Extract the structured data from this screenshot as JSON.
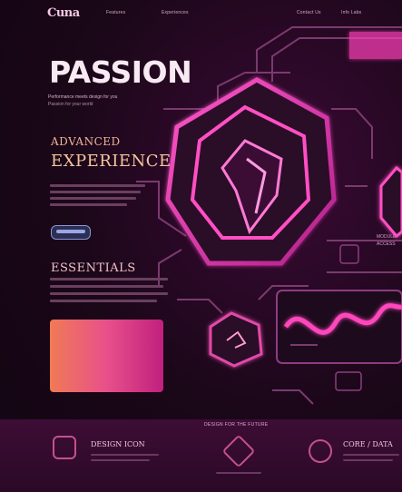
{
  "header": {
    "logo": "Cuna",
    "nav": [
      "Features",
      "Experiences",
      "Contact Us",
      "Info Labs"
    ]
  },
  "hero": {
    "title": "PASSION",
    "tagline": "Performance meets design for you",
    "tagline2": "Passion for your world"
  },
  "section1": {
    "heading_small": "ADVANCED",
    "heading_big": "EXPERIENCE"
  },
  "section2": {
    "heading": "ESSENTIALS"
  },
  "bottom": {
    "caption": "DESIGN FOR THE FUTURE",
    "features": [
      {
        "title": "DESIGN ICON",
        "icon": "app-icon"
      },
      {
        "title": "",
        "icon": "diamond-icon"
      },
      {
        "title": "CORE / DATA",
        "icon": "globe-icon"
      }
    ]
  },
  "right_panel": {
    "labels": [
      "MODULE",
      "ACCESS"
    ]
  },
  "colors": {
    "accent": "#ff3fb8",
    "background": "#1a0718",
    "card_start": "#f07a55",
    "card_end": "#c0207e"
  }
}
